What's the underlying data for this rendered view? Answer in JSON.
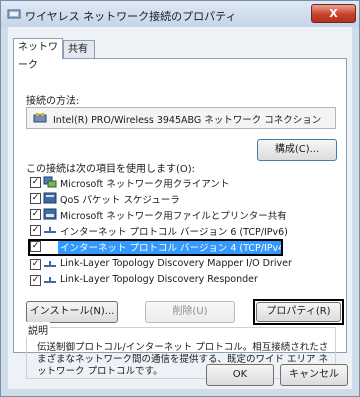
{
  "window": {
    "title": "ワイヤレス ネットワーク接続のプロパティ",
    "close_label": "X"
  },
  "tabs": [
    {
      "label": "ネットワーク"
    },
    {
      "label": "共有"
    }
  ],
  "connection": {
    "label": "接続の方法:",
    "adapter": "Intel(R) PRO/Wireless 3945ABG ネットワーク コネクション"
  },
  "buttons": {
    "configure": "構成(C)...",
    "install": "インストール(N)...",
    "uninstall": "削除(U)",
    "properties": "プロパティ(R)",
    "ok": "OK",
    "cancel": "キャンセル"
  },
  "items_label": "この接続は次の項目を使用します(O):",
  "items": [
    {
      "label": "Microsoft ネットワーク用クライアント",
      "checked": true,
      "icon": "network-client-icon"
    },
    {
      "label": "QoS パケット スケジューラ",
      "checked": true,
      "icon": "qos-scheduler-icon"
    },
    {
      "label": "Microsoft ネットワーク用ファイルとプリンター共有",
      "checked": true,
      "icon": "file-printer-share-icon"
    },
    {
      "label": "インターネット プロトコル バージョン 6 (TCP/IPv6)",
      "checked": true,
      "icon": "protocol-icon"
    },
    {
      "label": "インターネット プロトコル バージョン 4 (TCP/IPv4)",
      "checked": true,
      "icon": "protocol-icon",
      "selected": true
    },
    {
      "label": "Link-Layer Topology Discovery Mapper I/O Driver",
      "checked": true,
      "icon": "protocol-icon"
    },
    {
      "label": "Link-Layer Topology Discovery Responder",
      "checked": true,
      "icon": "protocol-icon"
    }
  ],
  "description": {
    "label": "説明",
    "text": "伝送制御プロトコル/インターネット プロトコル。相互接続されたさまざまなネットワーク間の通信を提供する、既定のワイド エリア ネットワーク プロトコルです。"
  },
  "colors": {
    "selection": "#3399ff",
    "close": "#c7412a"
  }
}
